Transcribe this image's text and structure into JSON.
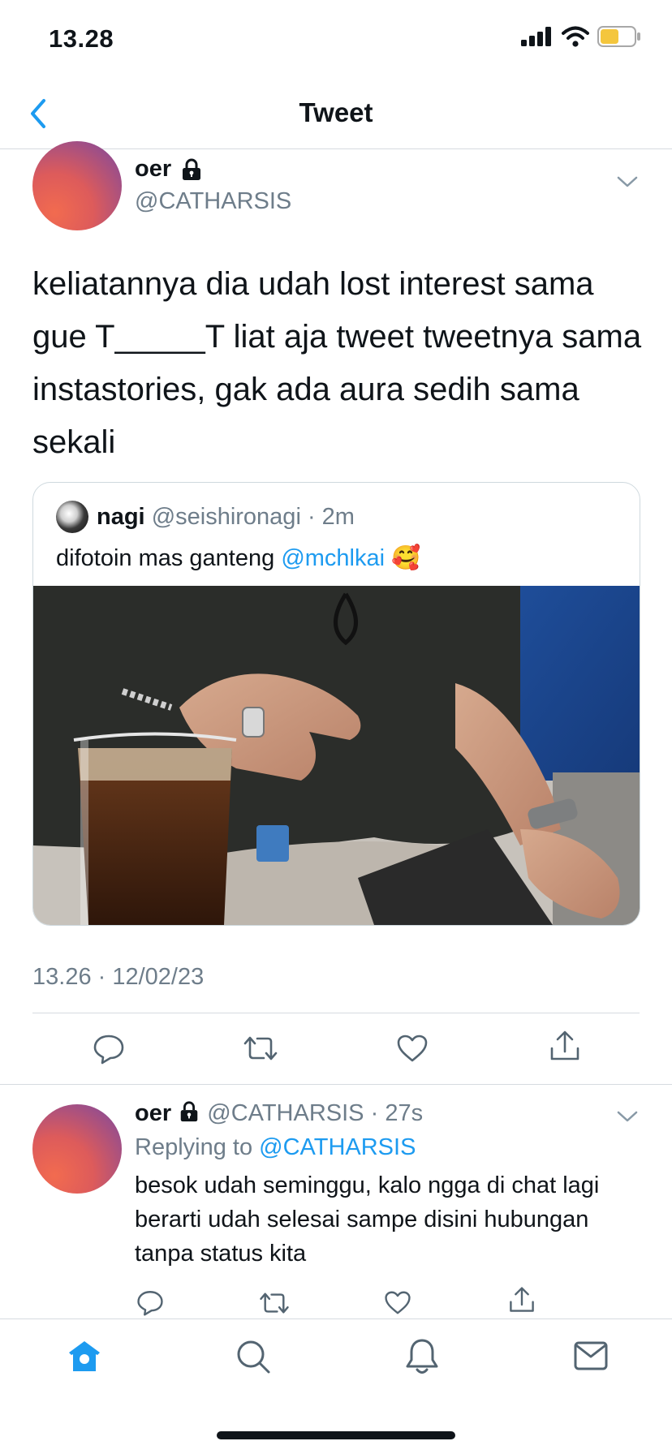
{
  "status_bar": {
    "time": "13.28",
    "battery_level": 0.55
  },
  "nav": {
    "title": "Tweet"
  },
  "tweet": {
    "author_name": "oer",
    "author_handle": "@CATHARSIS",
    "text": "keliatannya dia udah lost interest sama gue T_____T liat aja tweet tweetnya sama instastories, gak ada aura sedih sama sekali",
    "timestamp": "13.26 · 12/02/23"
  },
  "quote": {
    "author_name": "nagi",
    "author_handle": "@seishironagi",
    "separator": "·",
    "time": "2m",
    "text": "difotoin mas ganteng",
    "mention": "@mchlkai",
    "emoji": "🥰"
  },
  "reply": {
    "author_name": "oer",
    "author_handle": "@CATHARSIS",
    "separator": "·",
    "time": "27s",
    "replying_prefix": "Replying to",
    "replying_to": "@CATHARSIS",
    "text": "besok udah seminggu, kalo ngga di chat lagi berarti udah selesai sampe disini hubungan tanpa status kita"
  },
  "colors": {
    "accent": "#1d9bf0",
    "battery": "#f4c63d",
    "muted": "#6e7d8a"
  },
  "icons": [
    "back-icon",
    "lock-icon",
    "chevron-down-icon",
    "reply-icon",
    "retweet-icon",
    "like-icon",
    "share-icon",
    "home-icon",
    "search-icon",
    "notifications-icon",
    "messages-icon"
  ]
}
